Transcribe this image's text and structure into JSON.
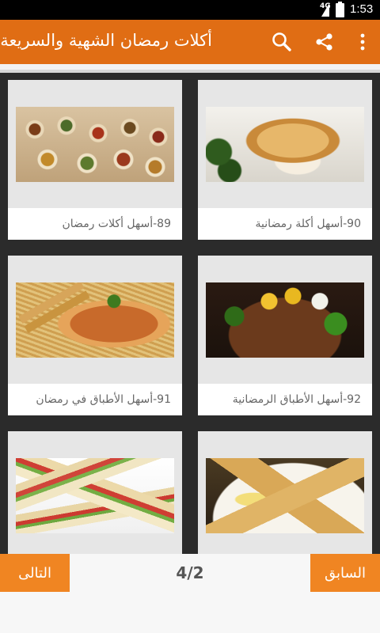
{
  "status_bar": {
    "network": "4G",
    "time": "1:53"
  },
  "toolbar": {
    "title": "أكلات رمضان الشهية والسريعة",
    "icons": [
      "search-icon",
      "share-icon",
      "more-vert-icon"
    ]
  },
  "cards": [
    {
      "caption": "90-أسهل أكلة رمضانية",
      "image": "chicken-cordon-bleu"
    },
    {
      "caption": "89-أسهل أكلات رمضان",
      "image": "buffet-spread"
    },
    {
      "caption": "92-أسهل الأطباق الرمضانية",
      "image": "grilled-fish-platter"
    },
    {
      "caption": "91-أسهل الأطباق في رمضان",
      "image": "pasta-dish"
    },
    {
      "caption": "",
      "image": "samosa-plate"
    },
    {
      "caption": "",
      "image": "club-sandwiches"
    }
  ],
  "pagination": {
    "prev_label": "السابق",
    "next_label": "التالى",
    "indicator": "4/2"
  },
  "colors": {
    "toolbar": "#e06d14",
    "button": "#f08522",
    "background": "#2b2b2b"
  }
}
